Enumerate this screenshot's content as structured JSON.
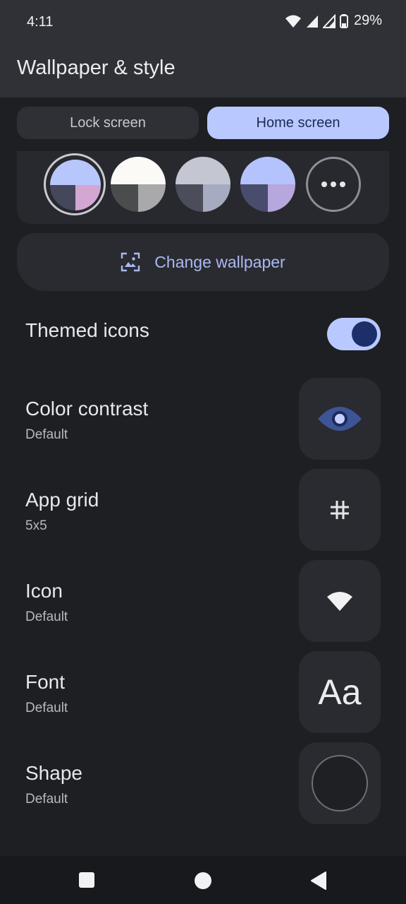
{
  "status": {
    "time": "4:11",
    "battery": "29%"
  },
  "appbar": {
    "title": "Wallpaper & style"
  },
  "tabs": [
    {
      "label": "Lock screen",
      "selected": false
    },
    {
      "label": "Home screen",
      "selected": true
    }
  ],
  "palette": {
    "options": [
      {
        "top": "#b8c7fb",
        "bottom_left": "#45485b",
        "bottom_right": "#d4a7d2",
        "selected": true
      },
      {
        "top": "#fbfaf7",
        "bottom_left": "#4b4c4e",
        "bottom_right": "#a9a9ab",
        "selected": false
      },
      {
        "top": "#c4c6d2",
        "bottom_left": "#4b4e5a",
        "bottom_right": "#a5abc0",
        "selected": false
      },
      {
        "top": "#b4c3fb",
        "bottom_left": "#4a4c6d",
        "bottom_right": "#b7a7dc",
        "selected": false
      }
    ],
    "more_icon": "more-horiz-icon"
  },
  "change_wallpaper": {
    "label": "Change wallpaper",
    "icon": "wallpaper-icon"
  },
  "themed_icons": {
    "label": "Themed icons",
    "on": true
  },
  "settings": [
    {
      "title": "Color contrast",
      "value": "Default",
      "icon": "eye-icon"
    },
    {
      "title": "App grid",
      "value": "5x5",
      "icon": "grid-icon"
    },
    {
      "title": "Icon",
      "value": "Default",
      "icon": "wifi-icon"
    },
    {
      "title": "Font",
      "value": "Default",
      "icon": "font-icon",
      "preview": "Aa"
    },
    {
      "title": "Shape",
      "value": "Default",
      "icon": "circle-shape-icon"
    }
  ],
  "colors": {
    "accent": "#b9c9ff",
    "background": "#1e1f23",
    "surface": "#2a2b30"
  }
}
